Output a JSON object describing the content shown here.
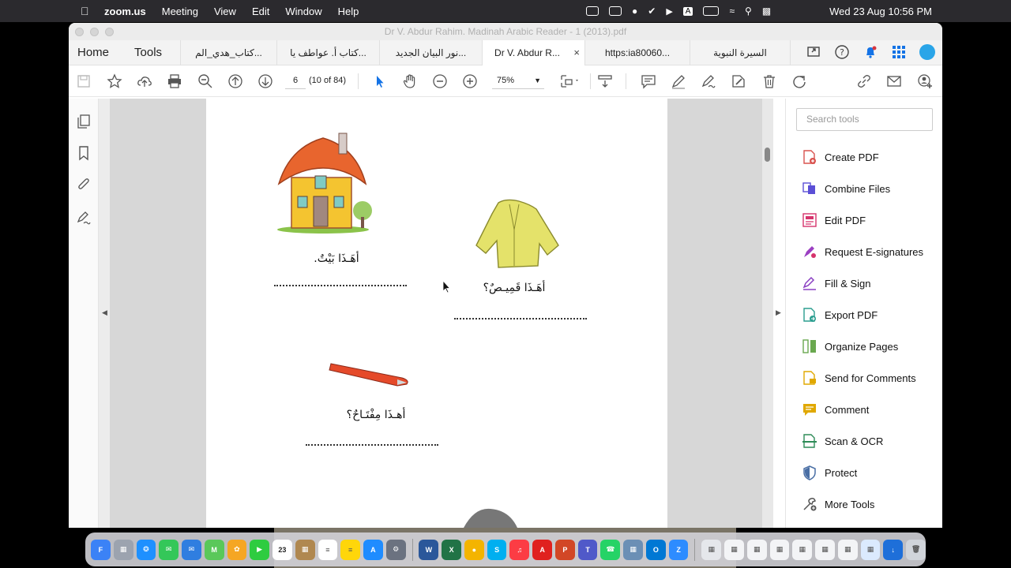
{
  "menubar": {
    "app_name": "zoom.us",
    "menus": [
      "Meeting",
      "View",
      "Edit",
      "Window",
      "Help"
    ],
    "clock": "Wed 23 Aug  10:56 PM"
  },
  "window": {
    "title": "Dr V. Abdur Rahim. Madinah Arabic Reader - 1 (2013).pdf"
  },
  "tabbar": {
    "home": "Home",
    "tools": "Tools",
    "tabs": [
      {
        "label": "كتاب_هدي_الم..."
      },
      {
        "label": "كتاب أ. عواطف يا..."
      },
      {
        "label": "نور البيان الجديد..."
      },
      {
        "label": "Dr V. Abdur R...",
        "close": "×"
      },
      {
        "label": "https:ia80060..."
      },
      {
        "label": "السيرة النبوية"
      }
    ]
  },
  "toolbar": {
    "page_number": "6",
    "page_count": "(10 of 84)",
    "zoom": "75%"
  },
  "document": {
    "caption_house": "أهَـذَا بَيْتٌ.",
    "caption_shirt": "أهَـذَا قَمِيـصٌ؟",
    "caption_key": "أهـذَا مِفْتَـاحٌ؟"
  },
  "right_pane": {
    "search_placeholder": "Search tools",
    "tools": [
      {
        "label": "Create PDF",
        "icon": "create-pdf-icon",
        "color": "#d9534f"
      },
      {
        "label": "Combine Files",
        "icon": "combine-files-icon",
        "color": "#5b4fd6"
      },
      {
        "label": "Edit PDF",
        "icon": "edit-pdf-icon",
        "color": "#d6336c"
      },
      {
        "label": "Request E-signatures",
        "icon": "esign-icon",
        "color": "#9b3fc2"
      },
      {
        "label": "Fill & Sign",
        "icon": "fill-sign-icon",
        "color": "#8a3fc2"
      },
      {
        "label": "Export PDF",
        "icon": "export-pdf-icon",
        "color": "#2a9d8f"
      },
      {
        "label": "Organize Pages",
        "icon": "organize-pages-icon",
        "color": "#6aa84f"
      },
      {
        "label": "Send for Comments",
        "icon": "send-comments-icon",
        "color": "#e0a800"
      },
      {
        "label": "Comment",
        "icon": "comment-icon",
        "color": "#e0a800"
      },
      {
        "label": "Scan & OCR",
        "icon": "scan-ocr-icon",
        "color": "#2e8b57"
      },
      {
        "label": "Protect",
        "icon": "protect-icon",
        "color": "#4a6fa5"
      },
      {
        "label": "More Tools",
        "icon": "more-tools-icon",
        "color": "#555555"
      }
    ]
  },
  "colors": {
    "accent_blue": "#1473e6"
  }
}
